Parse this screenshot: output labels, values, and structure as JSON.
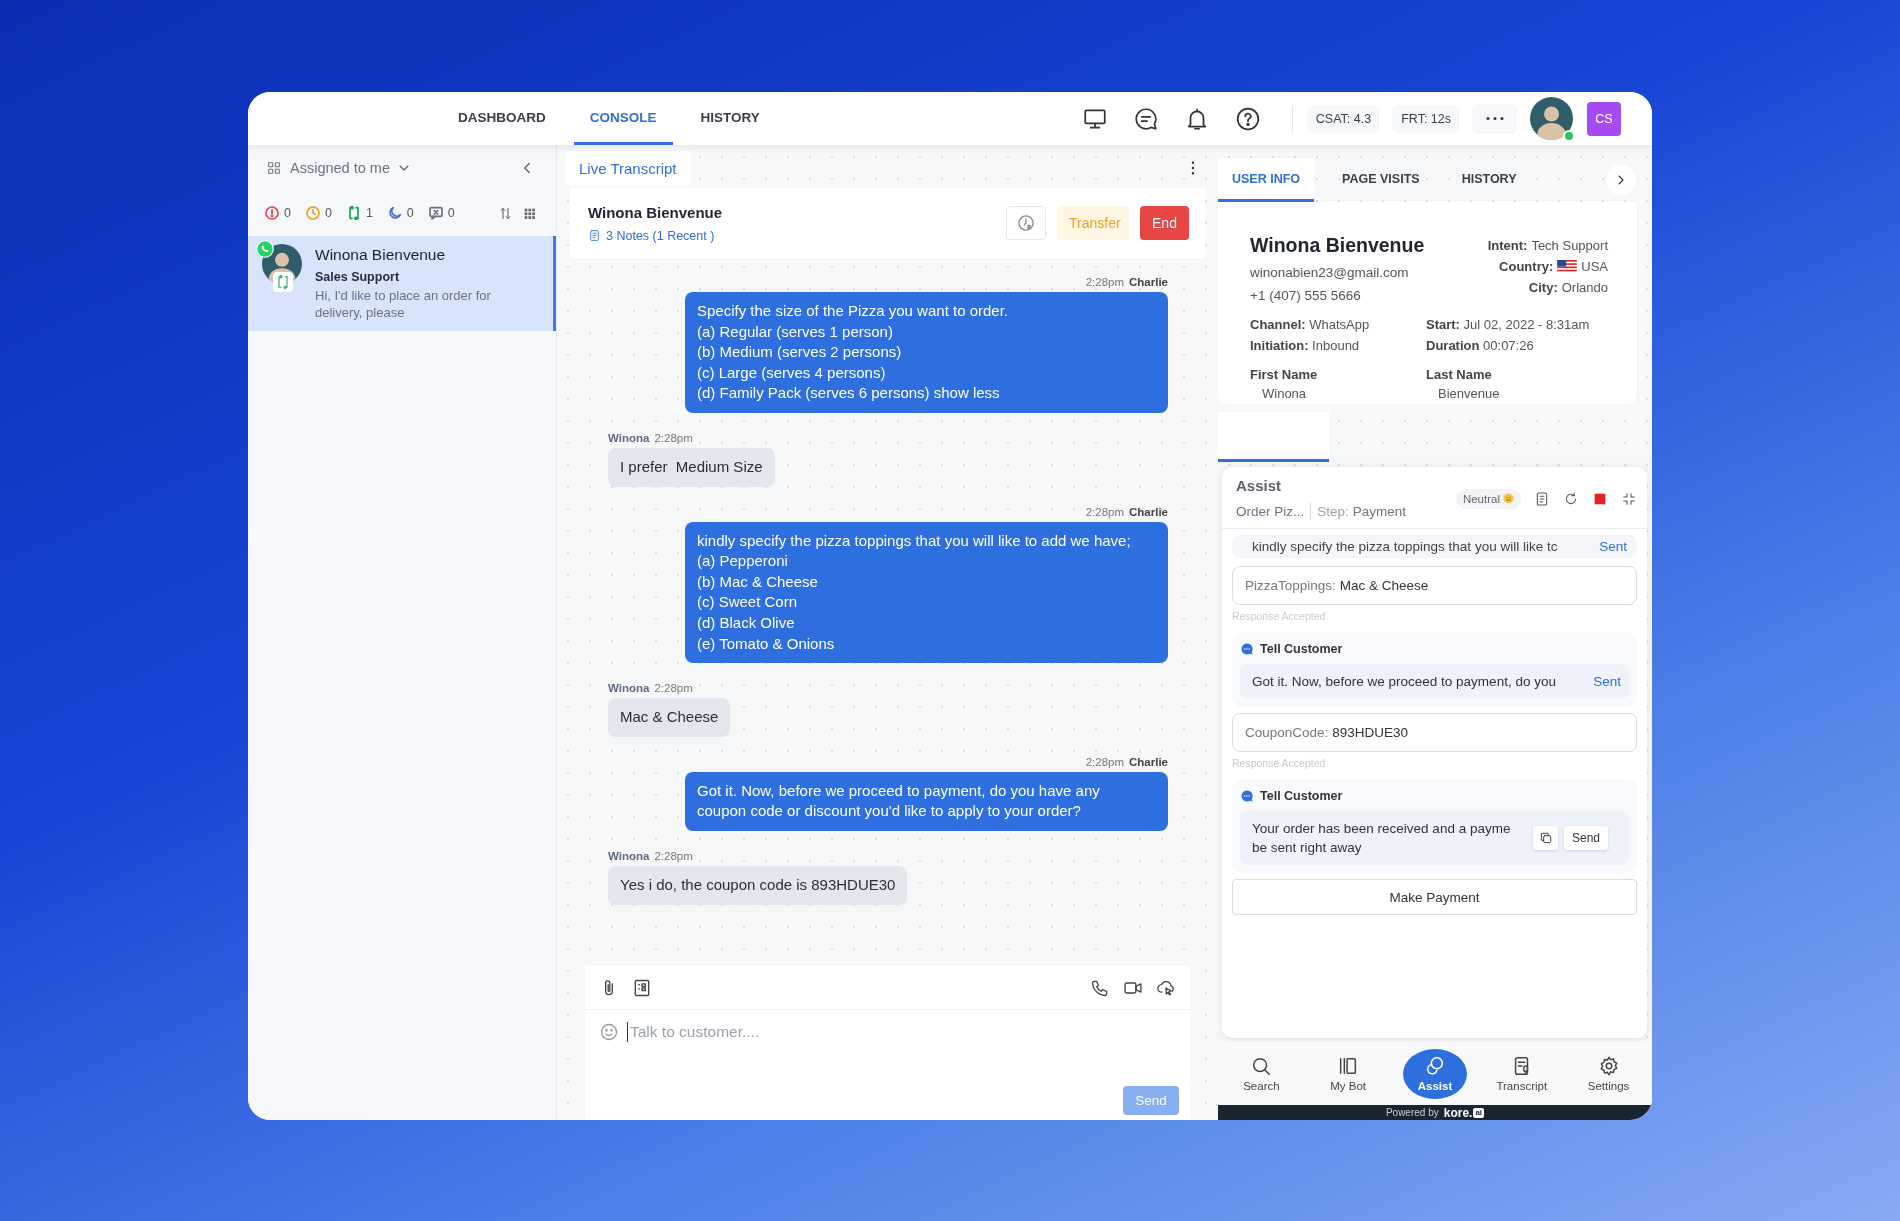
{
  "top_bar": {
    "tabs": [
      {
        "label": "DASHBOARD",
        "selected": false
      },
      {
        "label": "CONSOLE",
        "selected": true
      },
      {
        "label": "HISTORY",
        "selected": false
      }
    ],
    "stats": [
      "CSAT: 4.3",
      "FRT: 12s"
    ],
    "agent_online": true,
    "profile_initials": "CS"
  },
  "queue": {
    "filter": "Assigned to me",
    "counters": [
      {
        "kind": "alert",
        "count": "0",
        "color": "#e5484d"
      },
      {
        "kind": "waiting",
        "count": "0",
        "color": "#f0a020"
      },
      {
        "kind": "transfer",
        "count": "1",
        "color": "#22a55a"
      },
      {
        "kind": "away",
        "count": "0",
        "color": "#4a6fd8"
      },
      {
        "kind": "message",
        "count": "0",
        "color": "#6b7280"
      }
    ],
    "conversations": [
      {
        "name": "Winona Bienvenue",
        "queue": "Sales Support",
        "preview": "Hi, I'd like to place an order for delivery, please",
        "selected": true
      }
    ]
  },
  "transcript": {
    "tab": "Live Transcript",
    "customer": "Winona Bienvenue",
    "notes": "3 Notes (1 Recent )",
    "buttons": [
      {
        "kind": "transfer",
        "label": "Transfer"
      },
      {
        "kind": "end",
        "label": "End"
      }
    ],
    "messages": [
      {
        "kind": "agent",
        "time": "2:28pm",
        "sender": "Charlie",
        "lines": [
          "Specify the size of the Pizza you want to order.",
          "(a) Regular (serves 1 person)",
          "(b) Medium (serves 2 persons)",
          "(c) Large (serves 4 persons)",
          "(d) Family Pack (serves 6 persons) show less"
        ]
      },
      {
        "kind": "customer",
        "time": "2:28pm",
        "sender": "Winona",
        "lines": [
          "I prefer  Medium Size"
        ]
      },
      {
        "kind": "agent",
        "time": "2:28pm",
        "sender": "Charlie",
        "lines": [
          "kindly specify the pizza toppings that you will like to add we have;",
          "(a) Pepperoni",
          "(b) Mac & Cheese",
          "(c) Sweet Corn",
          "(d) Black Olive",
          "(e) Tomato & Onions"
        ]
      },
      {
        "kind": "customer",
        "time": "2:28pm",
        "sender": "Winona",
        "lines": [
          "Mac & Cheese"
        ]
      },
      {
        "kind": "agent",
        "time": "2:28pm",
        "sender": "Charlie",
        "lines": [
          "Got it. Now, before we proceed to payment, do you have any",
          "coupon code or discount you'd like to apply to your order?"
        ]
      },
      {
        "kind": "customer",
        "time": "2:28pm",
        "sender": "Winona",
        "lines": [
          "Yes i do, the coupon code is 893HDUE30"
        ]
      }
    ],
    "composer": {
      "placeholder": "Talk to customer....",
      "send": "Send",
      "send_disabled": true
    }
  },
  "side_tabs": [
    {
      "label": "USER INFO",
      "selected": true
    },
    {
      "label": "PAGE VISITS",
      "selected": false
    },
    {
      "label": "HISTORY",
      "selected": false
    }
  ],
  "user_info": {
    "name": "Winona Bienvenue",
    "email": "winonabien23@gmail.com",
    "phone": "+1 (407) 555 5666",
    "facts": [
      {
        "kind": "text",
        "label": "Intent:",
        "value": "Tech Support"
      },
      {
        "kind": "country",
        "label": "Country:",
        "value": "USA"
      },
      {
        "kind": "text",
        "label": "City:",
        "value": "Orlando"
      }
    ],
    "details": [
      {
        "label": "Channel:",
        "value": "WhatsApp"
      },
      {
        "label": "Start:",
        "value": "Jul 02, 2022 - 8:31am"
      },
      {
        "label": "Initiation:",
        "value": "Inbound"
      },
      {
        "label": "Duration",
        "value": "00:07:26"
      }
    ],
    "fields": [
      {
        "label": "First Name",
        "value": "Winona"
      },
      {
        "label": "Last Name",
        "value": "Bienvenue"
      }
    ]
  },
  "assist": {
    "title": "Assist",
    "flow": "Order Piz...",
    "step_label": "Step:",
    "step": "Payment",
    "sentiment": "Neutral",
    "items": [
      {
        "kind": "message",
        "text": "kindly specify the pizza toppings that you will like tc",
        "status": "Sent"
      },
      {
        "kind": "entity",
        "label": "PizzaToppings:",
        "value": "Mac & Cheese",
        "note": "Response Accepted"
      },
      {
        "kind": "tell",
        "title": "Tell Customer",
        "text": "Got it. Now, before we proceed to payment, do you",
        "status": "Sent"
      },
      {
        "kind": "entity",
        "label": "CouponCode:",
        "value": "893HDUE30",
        "note": "Response Accepted"
      },
      {
        "kind": "tell",
        "title": "Tell Customer",
        "text": "Your order has been received and a payme be sent right away",
        "action": "Send"
      },
      {
        "kind": "button",
        "label": "Make Payment"
      }
    ]
  },
  "bottom_nav": [
    {
      "kind": "search",
      "label": "Search",
      "selected": false
    },
    {
      "kind": "bot",
      "label": "My Bot",
      "selected": false
    },
    {
      "kind": "assist",
      "label": "Assist",
      "selected": true
    },
    {
      "kind": "transcript",
      "label": "Transcript",
      "selected": false
    },
    {
      "kind": "settings",
      "label": "Settings",
      "selected": false
    }
  ],
  "footer": {
    "powered_by": "Powered by",
    "brand": "kore.",
    "brand_badge": "ai"
  }
}
